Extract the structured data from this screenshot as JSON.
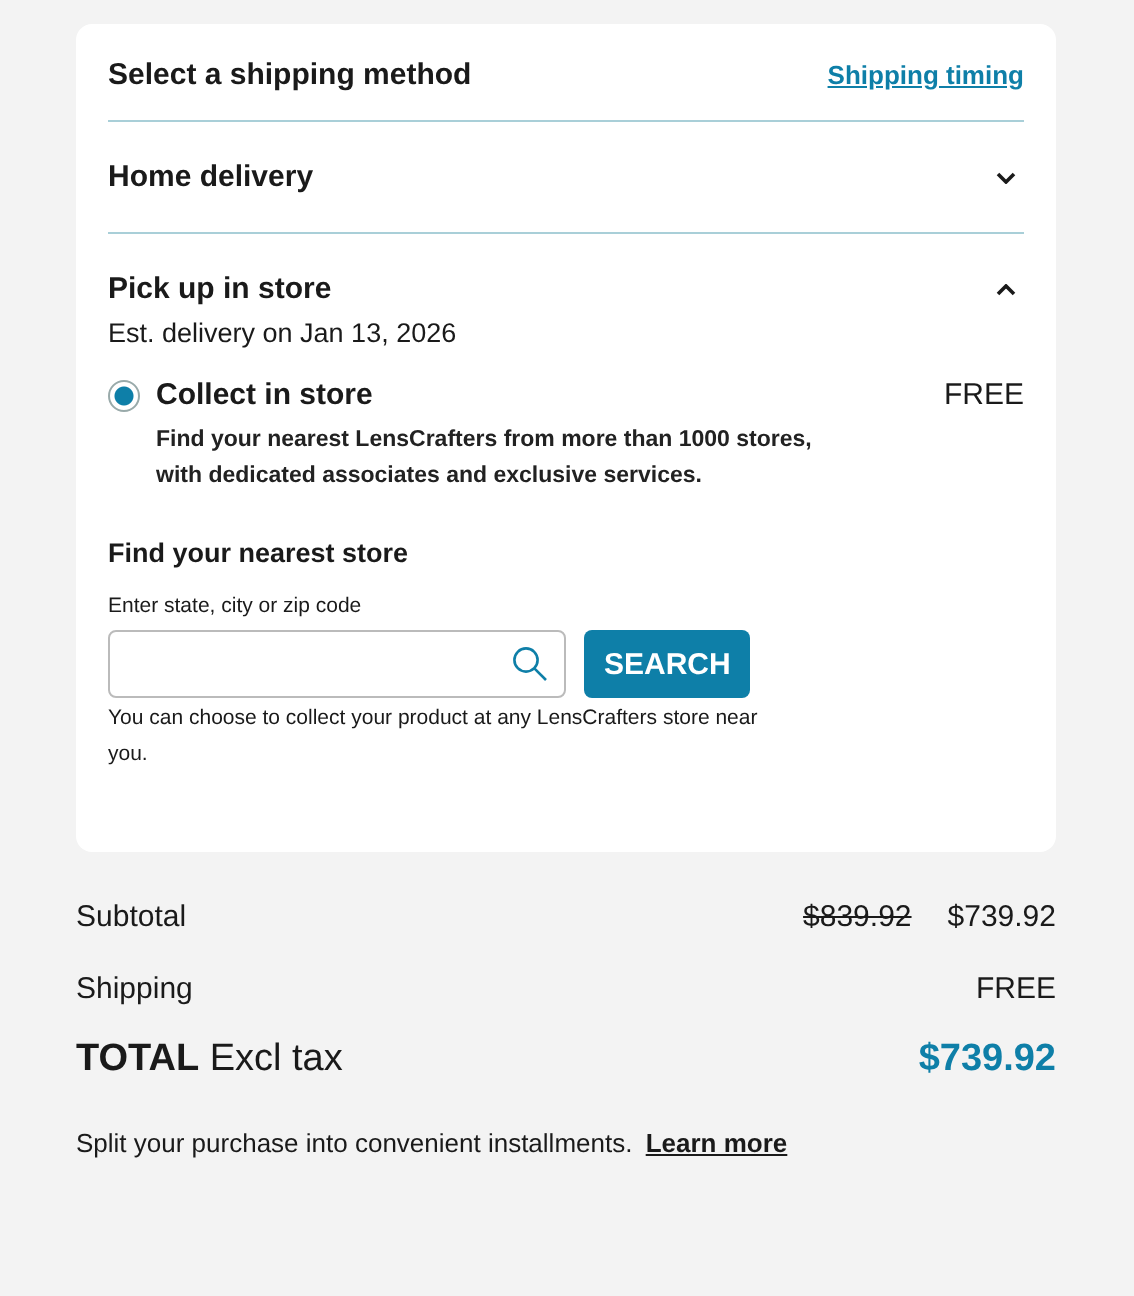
{
  "shipping": {
    "title": "Select a shipping method",
    "timing_link": "Shipping timing",
    "sections": [
      {
        "label": "Home delivery",
        "expanded": false
      },
      {
        "label": "Pick up in store",
        "expanded": true,
        "estimate": "Est. delivery on Jan 13, 2026",
        "options": [
          {
            "label": "Collect in store",
            "price": "FREE",
            "selected": true,
            "description": "Find your nearest LensCrafters from more than 1000 stores, with dedicated associates and exclusive services."
          }
        ],
        "store_finder": {
          "title": "Find your nearest store",
          "field_label": "Enter state, city or zip code",
          "button": "SEARCH",
          "note": "You can choose to collect your product at any LensCrafters store near you."
        }
      }
    ]
  },
  "summary": {
    "subtotal_label": "Subtotal",
    "subtotal_old": "$839.92",
    "subtotal": "$739.92",
    "shipping_label": "Shipping",
    "shipping": "FREE",
    "total_label": "**TOTAL** Excl tax",
    "total": "$739.92",
    "installments": "Split your purchase into convenient installments.",
    "learn_more": "Learn more"
  }
}
